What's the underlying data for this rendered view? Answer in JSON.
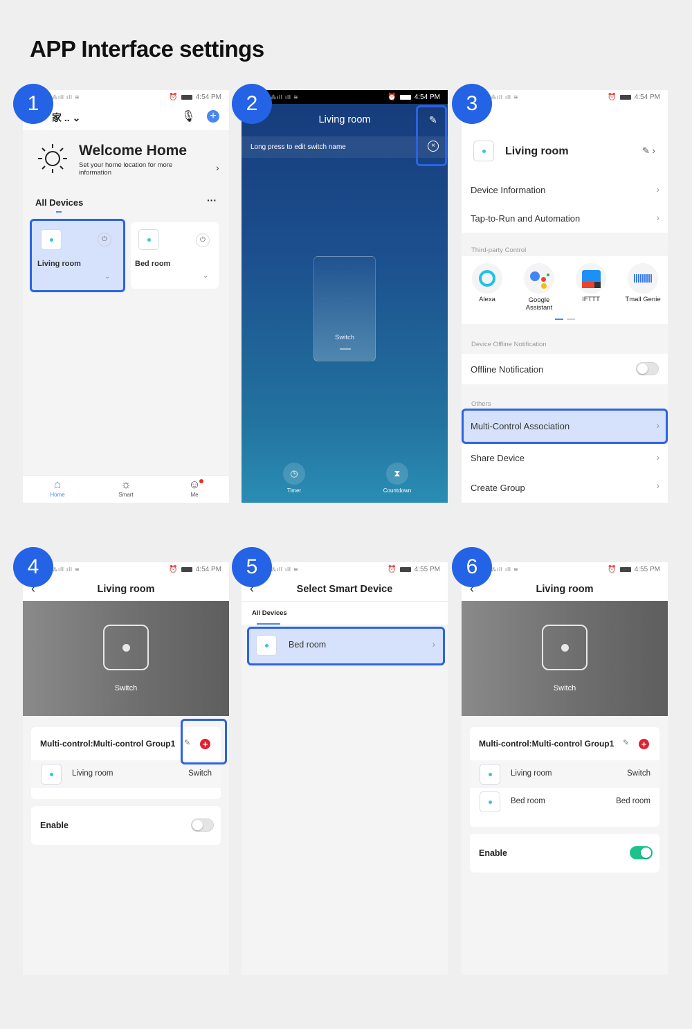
{
  "page_title": "APP Interface settings",
  "badges": [
    "1",
    "2",
    "3",
    "4",
    "5",
    "6"
  ],
  "status_times": [
    "4:54 PM",
    "4:54 PM",
    "4:54 PM",
    "4:54 PM",
    "4:55 PM",
    "4:55 PM"
  ],
  "colors": {
    "accent": "#2c63e2",
    "highlight_fill": "#d6e2fb",
    "toggle_on": "#1ec28b",
    "add_red": "#e0202e",
    "device_dot": "#3ec6c6"
  },
  "screen1": {
    "home_name": "家 ..",
    "welcome": "Welcome Home",
    "welcome_sub": "Set your home location for more information",
    "all_devices": "All Devices",
    "more": "···",
    "devices": [
      {
        "name": "Living room",
        "selected": true
      },
      {
        "name": "Bed room",
        "selected": false
      }
    ],
    "nav": [
      {
        "label": "Home",
        "icon": "home-icon",
        "active": true
      },
      {
        "label": "Smart",
        "icon": "sun-icon"
      },
      {
        "label": "Me",
        "icon": "profile-icon"
      }
    ]
  },
  "screen2": {
    "title": "Living room",
    "hint": "Long press to edit switch name",
    "switch_label": "Switch",
    "timer": "Timer",
    "countdown": "Countdown"
  },
  "screen3": {
    "device_name": "Living room",
    "rows1": [
      "Device Information",
      "Tap-to-Run and Automation"
    ],
    "third_party_header": "Third-party Control",
    "third_party": [
      "Alexa",
      "Google Assistant",
      "IFTTT",
      "Tmall Genie"
    ],
    "offline_header": "Device Offline Notification",
    "offline_label": "Offline Notification",
    "offline_enabled": false,
    "others_header": "Others",
    "others": [
      "Multi-Control Association",
      "Share Device",
      "Create Group"
    ]
  },
  "screen4": {
    "title": "Living room",
    "switch_label": "Switch",
    "group_title": "Multi-control:Multi-control Group1",
    "devices": [
      {
        "name": "Living room",
        "switch": "Switch"
      }
    ],
    "enable_label": "Enable",
    "enabled": false
  },
  "screen5": {
    "title": "Select Smart Device",
    "tab": "All Devices",
    "devices": [
      "Bed room"
    ]
  },
  "screen6": {
    "title": "Living room",
    "switch_label": "Switch",
    "group_title": "Multi-control:Multi-control Group1",
    "devices": [
      {
        "name": "Living room",
        "switch": "Switch"
      },
      {
        "name": "Bed room",
        "switch": "Bed room"
      }
    ],
    "enable_label": "Enable",
    "enabled": true
  }
}
